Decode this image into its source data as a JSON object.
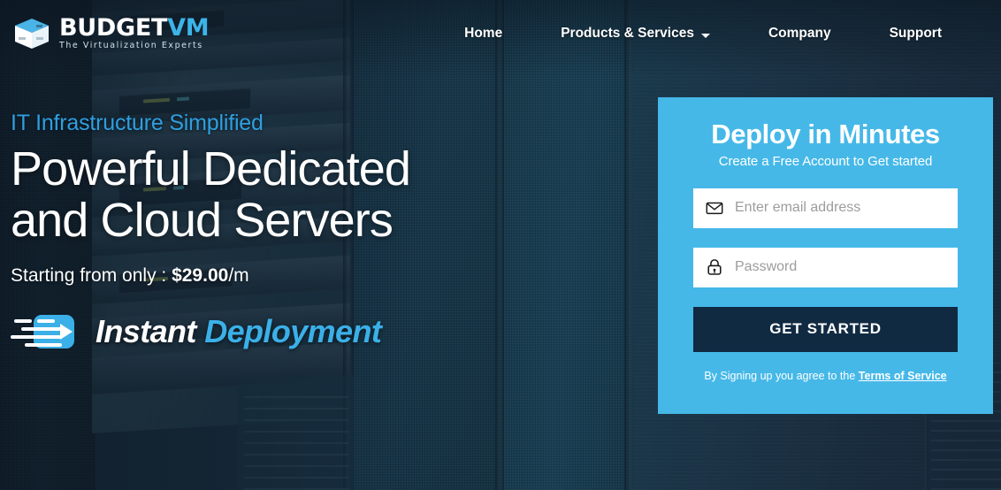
{
  "brand": {
    "logo_icon": "cube-box-icon",
    "name_primary": "BUDGET",
    "name_accent": "VM",
    "tagline": "The Virtualization Experts",
    "accent_color": "#3db4e8"
  },
  "nav": {
    "items": [
      {
        "label": "Home",
        "has_dropdown": false
      },
      {
        "label": "Products & Services",
        "has_dropdown": true
      },
      {
        "label": "Company",
        "has_dropdown": false
      },
      {
        "label": "Support",
        "has_dropdown": false
      }
    ]
  },
  "hero": {
    "eyebrow": "IT Infrastructure Simplified",
    "eyebrow_color": "#2f9fe0",
    "headline_line1": "Powerful Dedicated",
    "headline_line2": "and Cloud Servers",
    "price_prefix": "Starting from only : ",
    "price_amount": "$29.00",
    "price_suffix": "/m",
    "badge_icon": "speed-arrow-icon",
    "badge_word1": "Instant",
    "badge_word2": "Deployment"
  },
  "signup": {
    "title": "Deploy in Minutes",
    "subtitle": "Create a Free Account to Get started",
    "panel_color": "#45b8e8",
    "email": {
      "icon": "envelope-icon",
      "placeholder": "Enter email address",
      "value": ""
    },
    "password": {
      "icon": "lock-icon",
      "placeholder": "Password",
      "value": ""
    },
    "cta_label": "GET STARTED",
    "cta_color": "#102a42",
    "terms_prefix": "By Signing up you agree to the ",
    "terms_link": "Terms of Service"
  }
}
